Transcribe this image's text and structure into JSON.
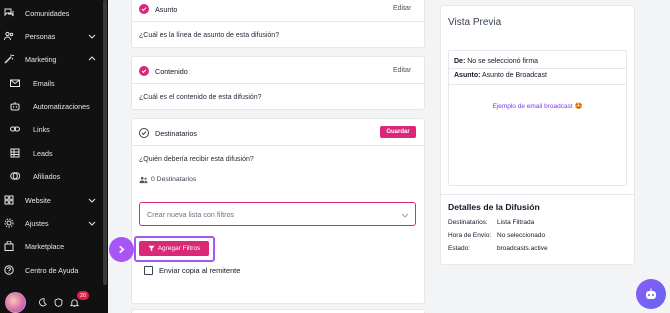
{
  "sidebar": {
    "items": [
      {
        "label": "Comunidades",
        "icon": "chat-bubbles-icon"
      },
      {
        "label": "Personas",
        "icon": "people-icon"
      },
      {
        "label": "Marketing",
        "icon": "magic-wand-icon"
      },
      {
        "label": "Emails",
        "icon": "mail-icon"
      },
      {
        "label": "Automatizaciones",
        "icon": "robot-icon"
      },
      {
        "label": "Links",
        "icon": "link-icon"
      },
      {
        "label": "Leads",
        "icon": "table-icon"
      },
      {
        "label": "Afiliados",
        "icon": "coins-icon"
      },
      {
        "label": "Website",
        "icon": "grid-icon"
      },
      {
        "label": "Ajustes",
        "icon": "gear-icon"
      },
      {
        "label": "Marketplace",
        "icon": "shopping-bag-icon"
      },
      {
        "label": "Centro de Ayuda",
        "icon": "help-circle-icon"
      }
    ],
    "notification_count": "20"
  },
  "steps": {
    "asunto": {
      "title": "Asunto",
      "action": "Editar",
      "question": "¿Cuál es la línea de asunto de esta difusión?"
    },
    "contenido": {
      "title": "Contenido",
      "action": "Editar",
      "question": "¿Cuál es el contenido de esta difusión?"
    },
    "destinatarios": {
      "title": "Destinatarios",
      "save_label": "Guardar",
      "question": "¿Quién debería recibir esta difusión?",
      "recipients_count": "0 Destinatarios",
      "list_placeholder": "Crear nueva lista con filtros",
      "add_filters_label": "Agregar Filtros",
      "copy_sender_label": "Enviar copia al remitente"
    }
  },
  "preview": {
    "title": "Vista Previa",
    "from_label": "De:",
    "from_value": "No se seleccionó firma",
    "subject_label": "Asunto:",
    "subject_value": "Asunto de Broadcast",
    "example_text": "Ejemplo de email broadcast 🤩"
  },
  "details": {
    "title": "Detalles de la Difusión",
    "rows": [
      {
        "label": "Destinatarios:",
        "value": "Lista Filtrada"
      },
      {
        "label": "Hora de Envío:",
        "value": "No seleccionado"
      },
      {
        "label": "Estado:",
        "value": "broadcasts.active"
      }
    ]
  },
  "colors": {
    "accent": "#db2777",
    "highlight": "#a855f7",
    "sidebar_bg": "#111111"
  }
}
